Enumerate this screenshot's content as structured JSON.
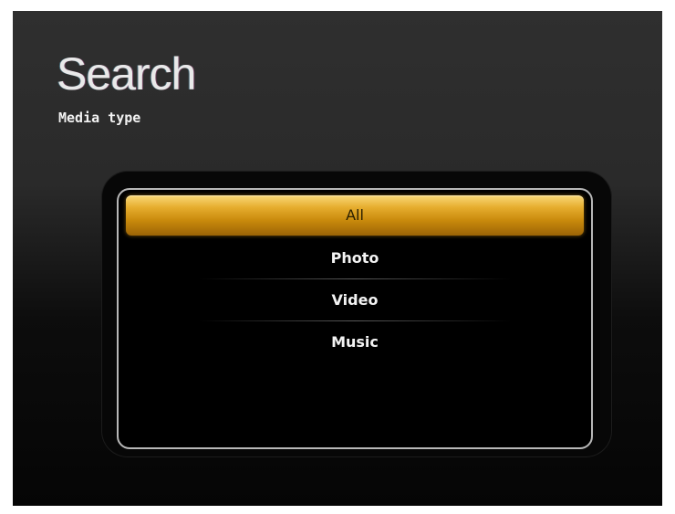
{
  "header": {
    "title": "Search",
    "subtitle": "Media type"
  },
  "menu": {
    "selected_index": 0,
    "items": [
      {
        "label": "All"
      },
      {
        "label": "Photo"
      },
      {
        "label": "Video"
      },
      {
        "label": "Music"
      }
    ]
  },
  "colors": {
    "background": "#2a2a2a",
    "selection": "#e6ad2e",
    "text": "#f3f3f3",
    "panel_border": "#b8b8b8"
  }
}
